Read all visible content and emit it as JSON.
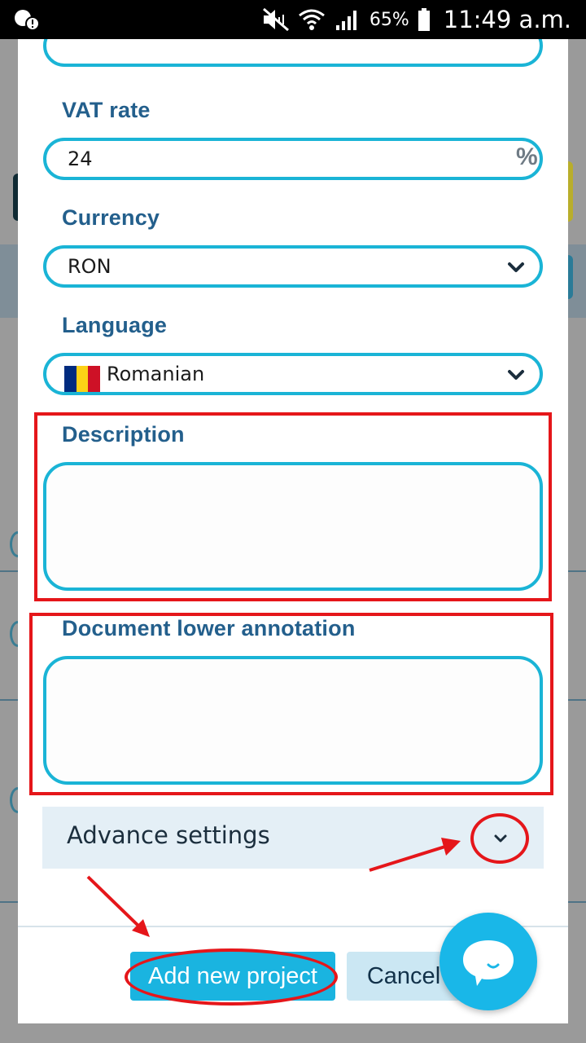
{
  "status_bar": {
    "battery_percent": "65%",
    "time": "11:49 a.m.",
    "icons": [
      "notification-icon",
      "mute-icon",
      "wifi-icon",
      "signal-icon",
      "battery-icon"
    ]
  },
  "form": {
    "vat_rate": {
      "label": "VAT rate",
      "value": "24",
      "unit": "%"
    },
    "currency": {
      "label": "Currency",
      "value": "RON"
    },
    "language": {
      "label": "Language",
      "value": "Romanian",
      "flag_colors": [
        "#002B7F",
        "#FCD116",
        "#CE1126"
      ]
    },
    "description": {
      "label": "Description",
      "value": ""
    },
    "lower_annotation": {
      "label": "Document lower annotation",
      "value": ""
    },
    "advance_settings": {
      "label": "Advance settings"
    }
  },
  "buttons": {
    "add_project": "Add new project",
    "cancel": "Cancel"
  },
  "colors": {
    "accent": "#1ab4d6",
    "label": "#235f8c",
    "highlight": "#e5161a",
    "advance_bg": "#e4eff6"
  }
}
